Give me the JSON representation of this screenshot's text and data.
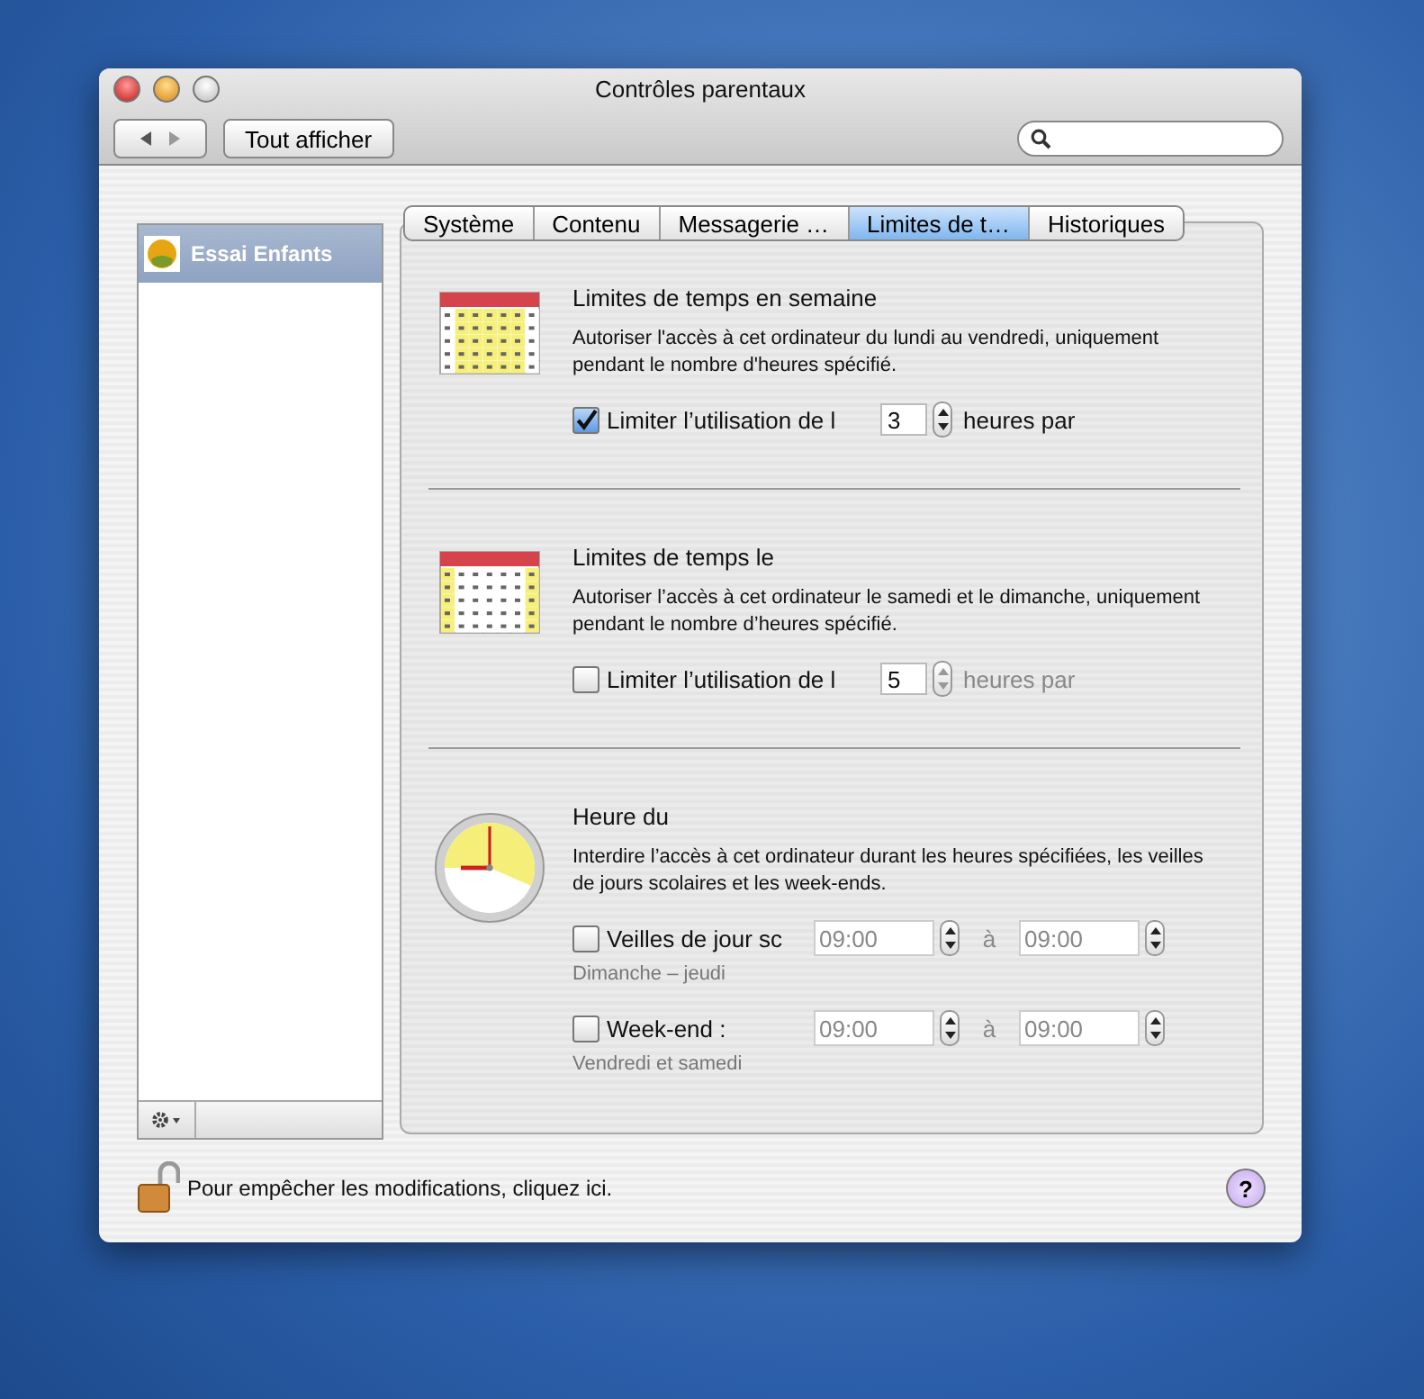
{
  "window": {
    "title": "Contrôles parentaux"
  },
  "toolbar": {
    "show_all": "Tout afficher"
  },
  "sidebar": {
    "items": [
      {
        "label": "Essai Enfants",
        "selected": true
      }
    ]
  },
  "tabs": [
    {
      "label": "Système",
      "selected": false
    },
    {
      "label": "Contenu",
      "selected": false
    },
    {
      "label": "Messagerie …",
      "selected": false
    },
    {
      "label": "Limites de t…",
      "selected": true
    },
    {
      "label": "Historiques",
      "selected": false
    }
  ],
  "sections": [
    {
      "kind": "weekday",
      "title": "Limites de temps en semaine",
      "description": "Autoriser l'accès à cet ordinateur du lundi au vendredi, uniquement pendant le nombre d'heures spécifié.",
      "limit": {
        "label": "Limiter l’utilisation de l",
        "checked": true,
        "value": "3",
        "unit": "heures par"
      }
    },
    {
      "kind": "weekend",
      "title": "Limites de temps le",
      "description": "Autoriser l’accès à cet ordinateur le samedi et le dimanche, uniquement pendant le nombre d’heures spécifié.",
      "limit": {
        "label": "Limiter l’utilisation de l",
        "checked": false,
        "value": "5",
        "unit": "heures par"
      }
    },
    {
      "kind": "bedtime",
      "title": "Heure du",
      "description": "Interdire l’accès à cet ordinateur durant les heures spécifiées, les veilles de jours scolaires et les week-ends.",
      "rows": [
        {
          "label": "Veilles de jour sc",
          "sublabel": "Dimanche – jeudi",
          "checked": false,
          "from": "09:00",
          "separator": "à",
          "to": "09:00"
        },
        {
          "label": "Week-end :",
          "sublabel": "Vendredi et samedi",
          "checked": false,
          "from": "09:00",
          "separator": "à",
          "to": "09:00"
        }
      ]
    }
  ],
  "footer": {
    "lock_text": "Pour empêcher les modifications, cliquez ici.",
    "help": "?"
  }
}
